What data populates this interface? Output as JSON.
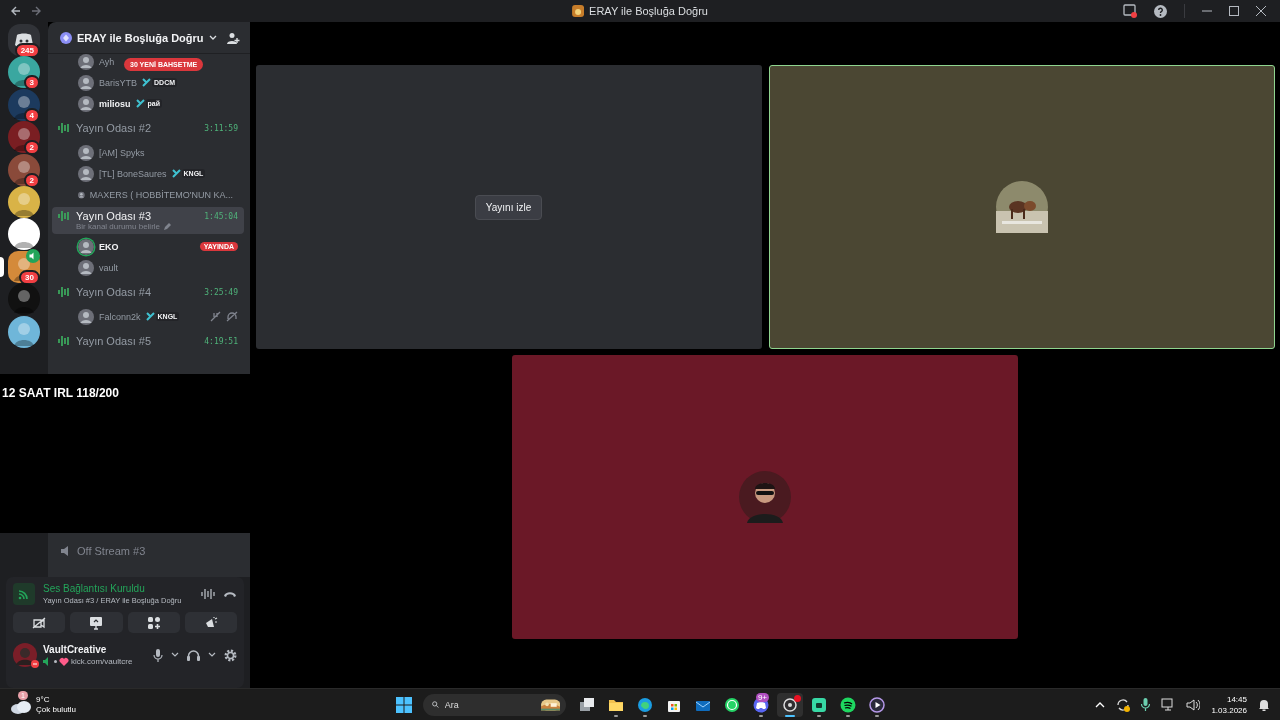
{
  "window": {
    "title": "ERAY ile Boşluğa Doğru"
  },
  "servers": [
    {
      "kind": "home",
      "badge": "245",
      "selected": false,
      "voice": false
    },
    {
      "kind": "server",
      "badge": "3",
      "selected": false,
      "voice": false
    },
    {
      "kind": "server",
      "badge": "4",
      "selected": false,
      "voice": false
    },
    {
      "kind": "server",
      "badge": "2",
      "selected": false,
      "voice": false
    },
    {
      "kind": "server",
      "badge": "2",
      "selected": false,
      "voice": false
    },
    {
      "kind": "server",
      "selected": false,
      "voice": false
    },
    {
      "kind": "server",
      "selected": false,
      "voice": false
    },
    {
      "kind": "server",
      "badge": "30",
      "selected": true,
      "voice": true
    },
    {
      "kind": "server",
      "selected": false,
      "voice": false
    },
    {
      "kind": "server",
      "selected": false,
      "voice": false
    }
  ],
  "server_header": {
    "name": "ERAY ile Boşluğa Doğru"
  },
  "mention_pill": "30 YENİ BAHSETME",
  "top_members": [
    {
      "name": "Ayh",
      "active": false,
      "speaking": false
    },
    {
      "name": "BarisYTB",
      "tag": "DDCM",
      "active": false,
      "speaking": false
    },
    {
      "name": "miliosu",
      "tag": "paй",
      "active": true,
      "speaking": false
    }
  ],
  "voice_channels": [
    {
      "name": "Yayın Odası #2",
      "timer": "3:11:59",
      "selected": false,
      "members": [
        {
          "name": "[AM] Spyks",
          "active": false,
          "speaking": false
        },
        {
          "name": "[TL] BoneSaures",
          "tag": "KNGL",
          "active": false,
          "speaking": false
        },
        {
          "name": "MAXERS ( HOBBİTEMO'NUN KA...",
          "active": false,
          "speaking": false
        }
      ]
    },
    {
      "name": "Yayın Odası #3",
      "timer": "1:45:04",
      "selected": true,
      "status": "Bir kanal durumu belirle",
      "members": [
        {
          "name": "EKO",
          "active": true,
          "speaking": true,
          "live": "YAYINDA"
        },
        {
          "name": "vault",
          "active": false,
          "speaking": false
        }
      ]
    },
    {
      "name": "Yayın Odası #4",
      "timer": "3:25:49",
      "selected": false,
      "members": [
        {
          "name": "Falconn2k",
          "tag": "KNGL",
          "active": false,
          "speaking": false,
          "muted": true,
          "deafened": true
        }
      ]
    },
    {
      "name": "Yayın Odası #5",
      "timer": "4:19:51",
      "selected": false
    }
  ],
  "overlay_text": "12 SAAT IRL 118/200",
  "lower_channels": [
    {
      "name": "Off Stream #3"
    }
  ],
  "voice_panel": {
    "status": "Ses Bağlantısı Kuruldu",
    "location": "Yayın Odası #3 / ERAY ile Boşluğa Doğru"
  },
  "user": {
    "name": "VaultCreative",
    "status": "kick.com/vaultcre"
  },
  "tiles": [
    {
      "kind": "stream",
      "button": "Yayını izle",
      "color": "#2b2d31",
      "speaking": false
    },
    {
      "kind": "user",
      "color": "#4b4733",
      "speaking": true
    },
    {
      "kind": "user",
      "color": "#6b1827",
      "speaking": false
    }
  ],
  "taskbar": {
    "weather": {
      "badge": "1",
      "temp": "9°C",
      "text": "Çok bulutlu"
    },
    "search": {
      "placeholder": "Ara"
    },
    "apps": [
      {
        "kind": "taskview",
        "running": false,
        "selected": false
      },
      {
        "kind": "folder",
        "running": true,
        "selected": false
      },
      {
        "kind": "edge",
        "running": true,
        "selected": false
      },
      {
        "kind": "store",
        "running": false,
        "selected": false
      },
      {
        "kind": "mail",
        "running": false,
        "selected": false
      },
      {
        "kind": "whatsapp",
        "running": false,
        "selected": false
      },
      {
        "kind": "discord",
        "badge": "9+",
        "running": true,
        "selected": false
      },
      {
        "kind": "obs",
        "running": true,
        "selected": true,
        "alert": true
      },
      {
        "kind": "box",
        "running": true,
        "selected": false
      },
      {
        "kind": "spotify",
        "running": true,
        "selected": false
      },
      {
        "kind": "player",
        "running": true,
        "selected": false
      }
    ],
    "clock": {
      "time": "14:45",
      "date": "1.03.2026"
    }
  }
}
